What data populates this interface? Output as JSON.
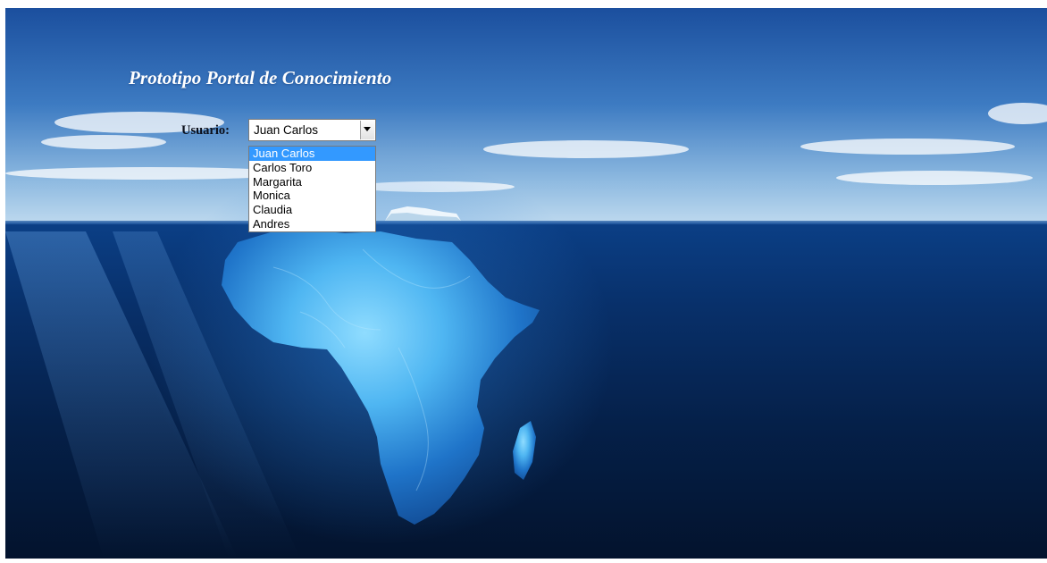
{
  "page": {
    "title": "Prototipo Portal de Conocimiento"
  },
  "form": {
    "user_label": "Usuario:",
    "selected_user": "Juan Carlos",
    "options": [
      {
        "label": "Juan Carlos",
        "selected": true
      },
      {
        "label": "Carlos Toro",
        "selected": false
      },
      {
        "label": "Margarita",
        "selected": false
      },
      {
        "label": "Monica",
        "selected": false
      },
      {
        "label": "Claudia",
        "selected": false
      },
      {
        "label": "Andres",
        "selected": false
      }
    ]
  },
  "background": {
    "description_icon": "iceberg-africa-image",
    "colors": {
      "sky_top": "#1b4f9e",
      "sky_horizon": "#bcd8ee",
      "ocean_surface": "#0b3f86",
      "ocean_deep": "#03132d",
      "ice": "#4fb6f2"
    }
  }
}
